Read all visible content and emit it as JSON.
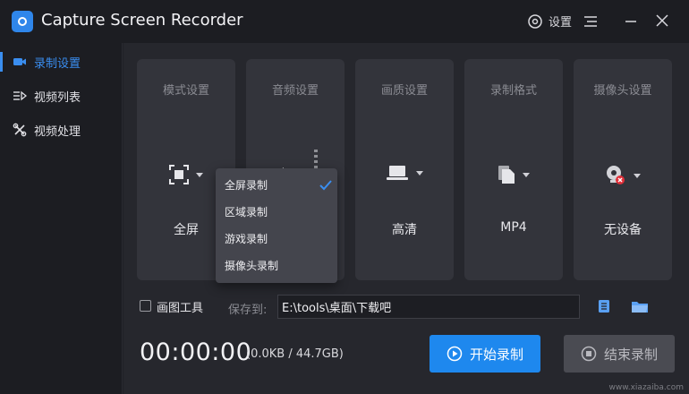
{
  "window": {
    "title": "Capture Screen Recorder",
    "settings_label": "设置"
  },
  "sidebar": {
    "items": [
      {
        "label": "录制设置",
        "icon": "camera-icon",
        "active": true
      },
      {
        "label": "视频列表",
        "icon": "list-icon",
        "active": false
      },
      {
        "label": "视频处理",
        "icon": "tools-icon",
        "active": false
      }
    ]
  },
  "cards": [
    {
      "title": "模式设置",
      "value": "全屏",
      "icon": "fullscreen-icon"
    },
    {
      "title": "音频设置",
      "value": "",
      "icon": "speaker-icon"
    },
    {
      "title": "画质设置",
      "value": "高清",
      "icon": "laptop-icon"
    },
    {
      "title": "录制格式",
      "value": "MP4",
      "icon": "file-icon"
    },
    {
      "title": "摄像头设置",
      "value": "无设备",
      "icon": "webcam-icon"
    }
  ],
  "mode_dropdown": {
    "options": [
      "全屏录制",
      "区域录制",
      "游戏录制",
      "摄像头录制"
    ],
    "selected": "全屏录制"
  },
  "draw_tool": {
    "label": "画图工具",
    "checked": false
  },
  "save": {
    "label": "保存到:",
    "path": "E:\\tools\\桌面\\下载吧"
  },
  "status": {
    "timer": "00:00:00",
    "size": "(0.0KB / 44.7GB)"
  },
  "buttons": {
    "start": "开始录制",
    "end": "结束录制"
  },
  "watermark": "www.xiazaiba.com",
  "colors": {
    "accent": "#1e88ee",
    "card": "#33343b",
    "background": "#26272d"
  }
}
